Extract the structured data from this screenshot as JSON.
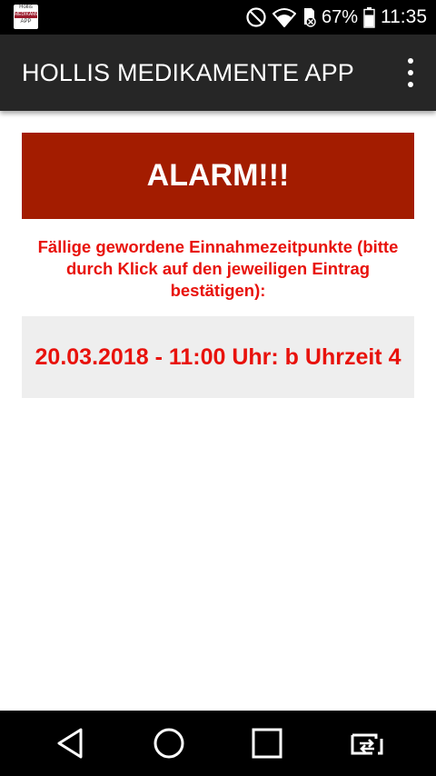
{
  "status_bar": {
    "app_icon_lines": [
      "Hollis",
      "MEDIKAMENTE",
      "APP"
    ],
    "battery_percent": "67%",
    "time": "11:35"
  },
  "toolbar": {
    "title": "HOLLIS MEDIKAMENTE APP"
  },
  "alarm": {
    "banner_text": "ALARM!!!",
    "instruction": "Fällige gewordene Einnahmezeitpunkte (bitte durch Klick auf den jeweiligen Eintrag bestätigen):",
    "entries": [
      {
        "label": "20.03.2018 - 11:00 Uhr: b Uhrzeit 4"
      }
    ]
  },
  "colors": {
    "banner_bg": "#a31c00",
    "alert_text": "#e8120c",
    "toolbar_bg": "#262626",
    "entry_bg": "#eeeeee"
  },
  "icons": {
    "status": [
      "do-not-disturb-icon",
      "wifi-icon",
      "sim-no-signal-icon",
      "battery-icon"
    ],
    "nav": [
      "back-icon",
      "home-icon",
      "recents-icon",
      "screen-switch-icon"
    ]
  }
}
